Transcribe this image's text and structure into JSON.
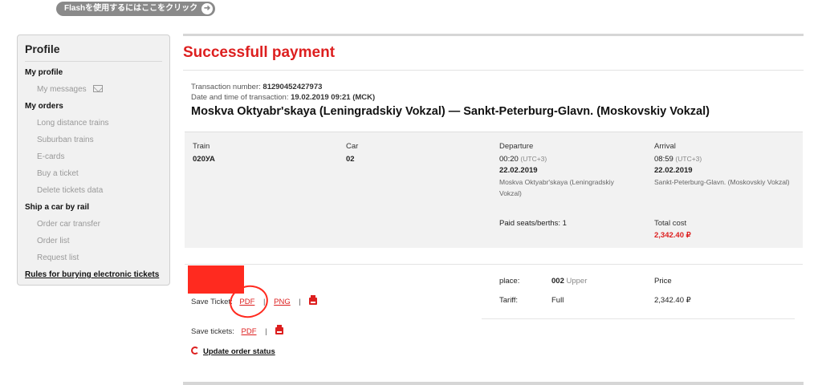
{
  "flash_banner": {
    "label": "Flashを使用するにはここをクリック"
  },
  "sidebar": {
    "title": "Profile",
    "items": [
      {
        "label": "My profile",
        "kind": "head"
      },
      {
        "label": "My messages",
        "kind": "sub",
        "icon": "envelope-icon"
      },
      {
        "label": "My orders",
        "kind": "head"
      },
      {
        "label": "Long distance trains",
        "kind": "sub"
      },
      {
        "label": "Suburban trains",
        "kind": "sub"
      },
      {
        "label": "E-cards",
        "kind": "sub"
      },
      {
        "label": "Buy a ticket",
        "kind": "sub"
      },
      {
        "label": "Delete tickets data",
        "kind": "sub"
      },
      {
        "label": "Ship a car by rail",
        "kind": "head"
      },
      {
        "label": "Order car transfer",
        "kind": "sub"
      },
      {
        "label": "Order list",
        "kind": "sub"
      },
      {
        "label": "Request list",
        "kind": "sub"
      },
      {
        "label": "Rules for burying electronic tickets",
        "kind": "rules"
      }
    ]
  },
  "main": {
    "title": "Successfull payment",
    "transaction_number_label": "Transaction number:",
    "transaction_number": "81290452427973",
    "transaction_date_label": "Date and time of transaction:",
    "transaction_date": "19.02.2019 09:21 (MCK)",
    "route": "Moskva Oktyabr'skaya (Leningradskiy Vokzal) — Sankt-Peterburg-Glavn. (Moskovskiy Vokzal)"
  },
  "trip": {
    "train_label": "Train",
    "train": "020УА",
    "car_label": "Car",
    "car": "02",
    "departure_label": "Departure",
    "departure_time": "00:20",
    "departure_tz": "(UTC+3)",
    "departure_date": "22.02.2019",
    "departure_station": "Moskva Oktyabr'skaya (Leningradskiy Vokzal)",
    "arrival_label": "Arrival",
    "arrival_time": "08:59",
    "arrival_tz": "(UTC+3)",
    "arrival_date": "22.02.2019",
    "arrival_station": "Sankt-Peterburg-Glavn. (Moskovskiy Vokzal)",
    "paid_seats": "Paid seats/berths: 1",
    "total_cost_label": "Total cost",
    "total_cost": "2,342.40 ₽"
  },
  "ticket": {
    "save_ticket_label": "Save Ticket:",
    "pdf_label": "PDF",
    "png_label": "PNG",
    "separator": "|",
    "place_label": "place:",
    "place_value": "002",
    "place_type": "Upper",
    "tariff_label": "Tariff:",
    "tariff_value": "Full",
    "price_label": "Price",
    "price_value": "2,342.40 ₽"
  },
  "footer_actions": {
    "save_tickets_label": "Save tickets:",
    "pdf_label": "PDF",
    "separator": "|",
    "update_label": "Update order status"
  },
  "colors": {
    "accent": "#dd1f1f",
    "annotation": "#ff2a1f",
    "panel": "#f2f2f2"
  }
}
